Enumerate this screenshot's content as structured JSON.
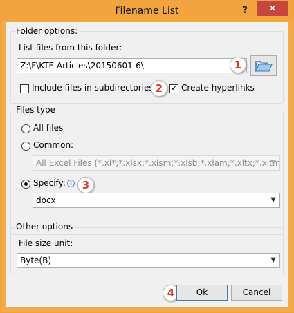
{
  "window": {
    "title": "Filename List",
    "help_glyph": "?",
    "close_glyph": "✕"
  },
  "folder_options": {
    "label": "Folder options:",
    "list_label": "List files from this folder:",
    "path_value": "Z:\\F\\KTE Articles\\20150601-6\\",
    "include_subdirs_label": "Include files in subdirectories",
    "include_subdirs_checked": false,
    "create_hyperlinks_label": "Create hyperlinks",
    "create_hyperlinks_checked": true
  },
  "files_type": {
    "label": "Files type",
    "all_files_label": "All files",
    "common_label": "Common:",
    "common_value": "All Excel Files (*.xl*;*.xlsx;*.xlsm;*.xlsb;*.xlam;*.xltx;*.xltm;*",
    "specify_label": "Specify:",
    "specify_value": "docx",
    "selected": "specify"
  },
  "other_options": {
    "label": "Other options",
    "size_unit_label": "File size unit:",
    "size_unit_value": "Byte(B)"
  },
  "buttons": {
    "ok_label": "Ok",
    "cancel_label": "Cancel"
  },
  "annotations": {
    "b1": "1",
    "b2": "2",
    "b3": "3",
    "b4": "4"
  },
  "colors": {
    "title_bar": "#f4a43e",
    "close_button": "#c7463b",
    "badge_text": "#e5392c"
  },
  "icons": {
    "folder": "folder-open-icon",
    "info": "info-icon"
  }
}
